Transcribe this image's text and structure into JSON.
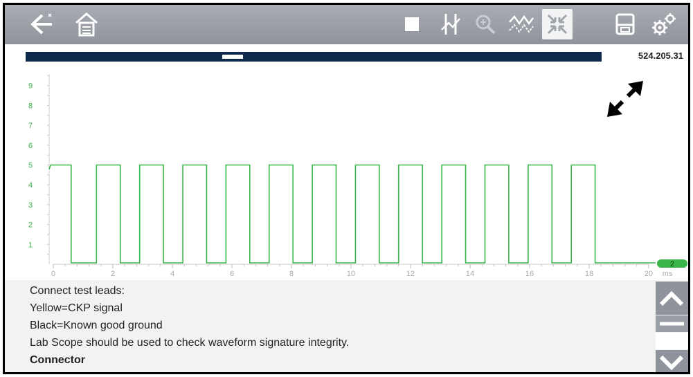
{
  "toolbar": {
    "icons": [
      "back-icon",
      "home-icon",
      "stop-icon",
      "cursors-icon",
      "zoom-icon",
      "trace-icon",
      "fullscreen-icon",
      "save-icon",
      "settings-icon"
    ]
  },
  "status": {
    "counter": "524.205.31"
  },
  "chart_data": {
    "type": "line",
    "title": "",
    "xlabel": "",
    "ylabel": "",
    "x_unit": "ms",
    "xlim": [
      0,
      20
    ],
    "ylim": [
      0,
      10
    ],
    "x_ticks": [
      "0",
      "2",
      "4",
      "6",
      "8",
      "10",
      "12",
      "14",
      "16",
      "18",
      "20"
    ],
    "y_ticks": [
      "1",
      "2",
      "3",
      "4",
      "5",
      "6",
      "7",
      "8",
      "9"
    ],
    "channel_badge": "2",
    "grid": false,
    "series": [
      {
        "color": "#39b54a",
        "high": 5.0,
        "low": 0.0,
        "pulses": [
          [
            -0.1,
            0.6
          ],
          [
            1.45,
            2.25
          ],
          [
            2.9,
            3.7
          ],
          [
            4.35,
            5.15
          ],
          [
            5.8,
            6.6
          ],
          [
            7.25,
            8.05
          ],
          [
            8.7,
            9.5
          ],
          [
            10.15,
            10.95
          ],
          [
            11.6,
            12.4
          ],
          [
            13.05,
            13.85
          ],
          [
            14.5,
            15.3
          ],
          [
            15.95,
            16.75
          ],
          [
            17.4,
            18.2
          ]
        ]
      }
    ]
  },
  "info": {
    "lines": [
      "Connect test leads:",
      "Yellow=CKP signal",
      "Black=Known good ground",
      "Lab Scope should be used to check waveform signature integrity."
    ],
    "bold_line": "Connector"
  },
  "colors": {
    "toolbar": "#9a9da4",
    "progress": "#0f2a4c",
    "signal": "#39b54a",
    "info_bg": "#f2f2f2"
  }
}
